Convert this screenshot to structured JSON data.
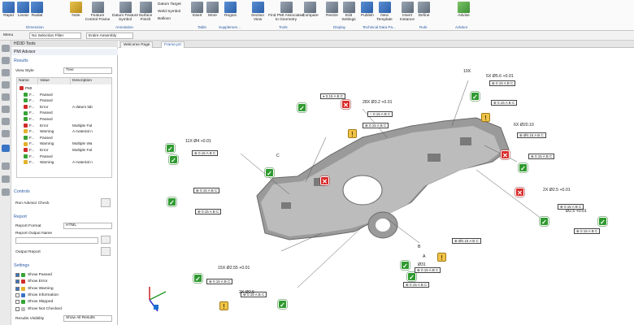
{
  "ribbon": {
    "buttons": [
      "Rapid",
      "Linear",
      "Radial",
      "Note",
      "Feature Control Frame",
      "Datum Feature Symbol",
      "Surface Finish",
      "Datum Target",
      "Weld Symbol",
      "Balloon",
      "Insert",
      "More",
      "Region",
      "Section View",
      "Find PMI Associated to Geometry",
      "Compare",
      "Resize",
      "Edit Settings",
      "Publish",
      "New Template",
      "Insert Instance",
      "Define",
      "Advise"
    ],
    "groups": [
      "Dimension",
      "Annotation",
      "Table",
      "Supplemen...",
      "Tools",
      "Display",
      "Technical Data Pa...",
      "Rule",
      "Advisor"
    ]
  },
  "cmdbar": {
    "menu": "Menu",
    "filter": "No Selection Filter",
    "assembly": "Entire Assembly"
  },
  "tabs": {
    "welcome": "Welcome Page",
    "part": "Frame.prt"
  },
  "panel": {
    "header": "HD3D Tools",
    "title": "PMI Advisor",
    "results_label": "Results",
    "view_style_label": "View Style",
    "view_style_value": "Tree",
    "columns": [
      "Name",
      "Value",
      "Description"
    ],
    "rows": [
      {
        "name": "PMI",
        "value": "",
        "desc": "",
        "status": "er"
      },
      {
        "name": "F...",
        "value": "Passed",
        "desc": "",
        "status": "ok"
      },
      {
        "name": "F...",
        "value": "Passed",
        "desc": "",
        "status": "ok"
      },
      {
        "name": "F...",
        "value": "Error",
        "desc": "A datum lab",
        "status": "er"
      },
      {
        "name": "F...",
        "value": "Passed",
        "desc": "",
        "status": "ok"
      },
      {
        "name": "F...",
        "value": "Passed",
        "desc": "",
        "status": "ok"
      },
      {
        "name": "F...",
        "value": "Error",
        "desc": "Multiple Fal",
        "status": "er"
      },
      {
        "name": "F...",
        "value": "Warning",
        "desc": "A material n",
        "status": "wa"
      },
      {
        "name": "F...",
        "value": "Passed",
        "desc": "",
        "status": "ok"
      },
      {
        "name": "F...",
        "value": "Warning",
        "desc": "Multiple Wa",
        "status": "wa"
      },
      {
        "name": "F...",
        "value": "Error",
        "desc": "Multiple Fal",
        "status": "er"
      },
      {
        "name": "F...",
        "value": "Passed",
        "desc": "",
        "status": "ok"
      },
      {
        "name": "F...",
        "value": "Warning",
        "desc": "A material n",
        "status": "wa"
      }
    ],
    "controls_label": "Controls",
    "run_check": "Run Advisor Check",
    "report_label": "Report",
    "report_format_label": "Report Format",
    "report_format_value": "HTML",
    "report_output_label": "Report Output Name",
    "output_report": "Output Report",
    "settings_label": "Settings",
    "settings": [
      {
        "label": "Show Passed",
        "status": "ok"
      },
      {
        "label": "Show Error",
        "status": "er"
      },
      {
        "label": "Show Warning",
        "status": "wa"
      },
      {
        "label": "Show Information",
        "status": "info"
      },
      {
        "label": "Show Skipped",
        "status": "skip"
      },
      {
        "label": "Show Not Checked",
        "status": "none"
      }
    ],
    "visibility_label": "Results Visibility",
    "visibility_value": "Show All Results"
  },
  "viewport": {
    "fcf": [
      "⌖ 0.15 A B C",
      "⊕ 0.15 A B C",
      "⊕ 0.15 A B C",
      "⊕ 0.15 A B C",
      "○ 0.15 A B C",
      "⊕ 0.15 A B C",
      "⊕ 0.15 A B C",
      "⊕ 0.15 A B C",
      "⊕ Ø0.15 A B C",
      "⊕ 0.15 A B C",
      "⊕ 0.15 A B C",
      "⊕ 0.15 A B C",
      "⊕ Ø0.15 A B C",
      "⊕ 0.15 A B C",
      "⊕ 0.15 A B C",
      "⊕ 0.15 A B C",
      "⊕ 0.15 A B C"
    ],
    "dims": [
      "10X",
      "5X Ø5.6 +0.01",
      "28X Ø3.2 +0.01",
      "11X Ø4 +0.01",
      "6X Ø20.10",
      "2X Ø2.5 +0.01",
      "Ø2.5 +0.01",
      "15X Ø2.55 +0.01",
      "2X Ø2.5",
      "Ø31",
      "C",
      "B",
      "A"
    ]
  }
}
